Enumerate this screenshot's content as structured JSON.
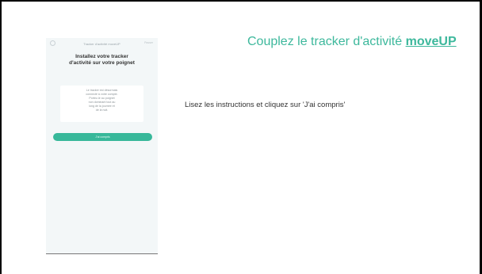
{
  "phone": {
    "header_title": "Tracker d'activité moveUP",
    "skip_label": "Passer",
    "title": "Installez votre tracker\nd'activité sur votre poignet",
    "body": "Le tracker est désormais\nconnecté à votre compte.\nPortez-le au poignet\nnon dominant tout au\nlong de la journée et\nde la nuit.",
    "button_label": "J'ai compris"
  },
  "main": {
    "heading_prefix": "Couplez le tracker d'activité ",
    "heading_brand": "moveUP",
    "instruction": "Lisez les instructions et cliquez sur 'J'ai compris'"
  },
  "colors": {
    "accent": "#3db89c",
    "button": "#37b89a",
    "text": "#333333"
  }
}
